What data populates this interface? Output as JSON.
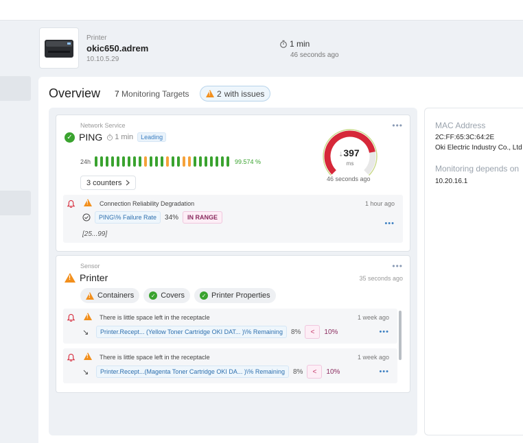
{
  "header": {
    "device_type": "Printer",
    "device_name": "okic650.adrem",
    "device_ip": "10.10.5.29",
    "interval": "1 min",
    "last_check": "46 seconds ago"
  },
  "overview": {
    "title": "Overview",
    "targets_count": "7",
    "targets_label": "Monitoring Targets",
    "issues_count": "2",
    "issues_label": "with issues"
  },
  "ping_card": {
    "type": "Network Service",
    "name": "PING",
    "interval": "1 min",
    "badge": "Leading",
    "history_label": "24h",
    "history_bars": [
      "green",
      "green",
      "green",
      "green",
      "green",
      "green",
      "green",
      "green",
      "green",
      "orange",
      "green",
      "green",
      "green",
      "orange",
      "green",
      "green",
      "orange",
      "orange",
      "green",
      "green",
      "green",
      "green",
      "green",
      "green",
      "green"
    ],
    "availability": "99.574 %",
    "counters_label": "3 counters",
    "gauge": {
      "value": "397",
      "unit": "ms",
      "min": 0,
      "max": 500,
      "fill": 397
    },
    "gauge_ago": "46 seconds ago",
    "alert": {
      "title": "Connection Reliability Degradation",
      "time": "1 hour ago",
      "metric": "PING\\% Failure Rate",
      "value": "34%",
      "status": "IN RANGE",
      "range": "[25...99]"
    }
  },
  "printer_card": {
    "type": "Sensor",
    "name": "Printer",
    "last_check": "35 seconds ago",
    "chips": [
      "Containers",
      "Covers",
      "Printer Properties"
    ],
    "alerts": [
      {
        "title": "There is little space left in the receptacle",
        "time": "1 week ago",
        "metric": "Printer.Recept... (Yellow Toner Cartridge OKI DAT... )\\% Remaining",
        "value": "8%",
        "op": "<",
        "threshold": "10%"
      },
      {
        "title": "There is little space left in the receptacle",
        "time": "1 week ago",
        "metric": "Printer.Recept...(Magenta Toner Cartridge OKI DA... )\\% Remaining",
        "value": "8%",
        "op": "<",
        "threshold": "10%"
      }
    ]
  },
  "details": {
    "mac_label": "MAC Address",
    "mac_value": "2C:FF:65:3C:64:2E",
    "vendor": "Oki Electric Industry Co., Ltd",
    "depends_label": "Monitoring depends on",
    "depends_value": "10.20.16.1"
  },
  "colors": {
    "green": "#3aa32f",
    "orange": "#f5a23a",
    "gauge_red": "#d62839",
    "accent": "#3c7fc1"
  }
}
